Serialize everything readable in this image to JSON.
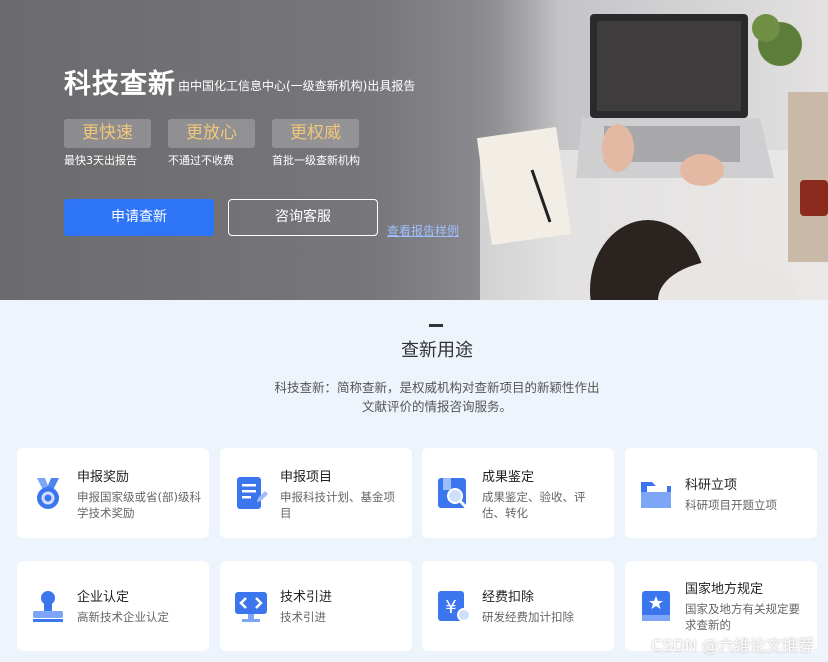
{
  "hero": {
    "title": "科技查新",
    "subtitle": "由中国化工信息中心(一级查新机构)出具报告",
    "tags": [
      {
        "label": "更快速",
        "caption": "最快3天出报告"
      },
      {
        "label": "更放心",
        "caption": "不通过不收费"
      },
      {
        "label": "更权威",
        "caption": "首批一级查新机构"
      }
    ],
    "apply_label": "申请查新",
    "consult_label": "咨询客服",
    "sample_link": "查看报告样例"
  },
  "section": {
    "title": "查新用途",
    "desc": "科技查新：简称查新，是权威机构对查新项目的新颖性作出文献评价的情报咨询服务。"
  },
  "cards": [
    {
      "title": "申报奖励",
      "desc": "申报国家级或省(部)级科学技术奖励",
      "icon": "medal-icon"
    },
    {
      "title": "申报项目",
      "desc": "申报科技计划、基金项目",
      "icon": "document-edit-icon"
    },
    {
      "title": "成果鉴定",
      "desc": "成果鉴定、验收、评估、转化",
      "icon": "book-search-icon"
    },
    {
      "title": "科研立项",
      "desc": "科研项目开题立项",
      "icon": "folder-icon"
    },
    {
      "title": "企业认定",
      "desc": "高新技术企业认定",
      "icon": "stamp-icon"
    },
    {
      "title": "技术引进",
      "desc": "技术引进",
      "icon": "monitor-code-icon"
    },
    {
      "title": "经费扣除",
      "desc": "研发经费加计扣除",
      "icon": "yen-document-icon"
    },
    {
      "title": "国家地方规定",
      "desc": "国家及地方有关规定要求查新的",
      "icon": "star-book-icon"
    }
  ],
  "watermark": "CSDN @六维论文推荐",
  "colors": {
    "primary": "#2d74f6",
    "tag_text": "#f1c779",
    "page_bg": "#eef4fc"
  }
}
